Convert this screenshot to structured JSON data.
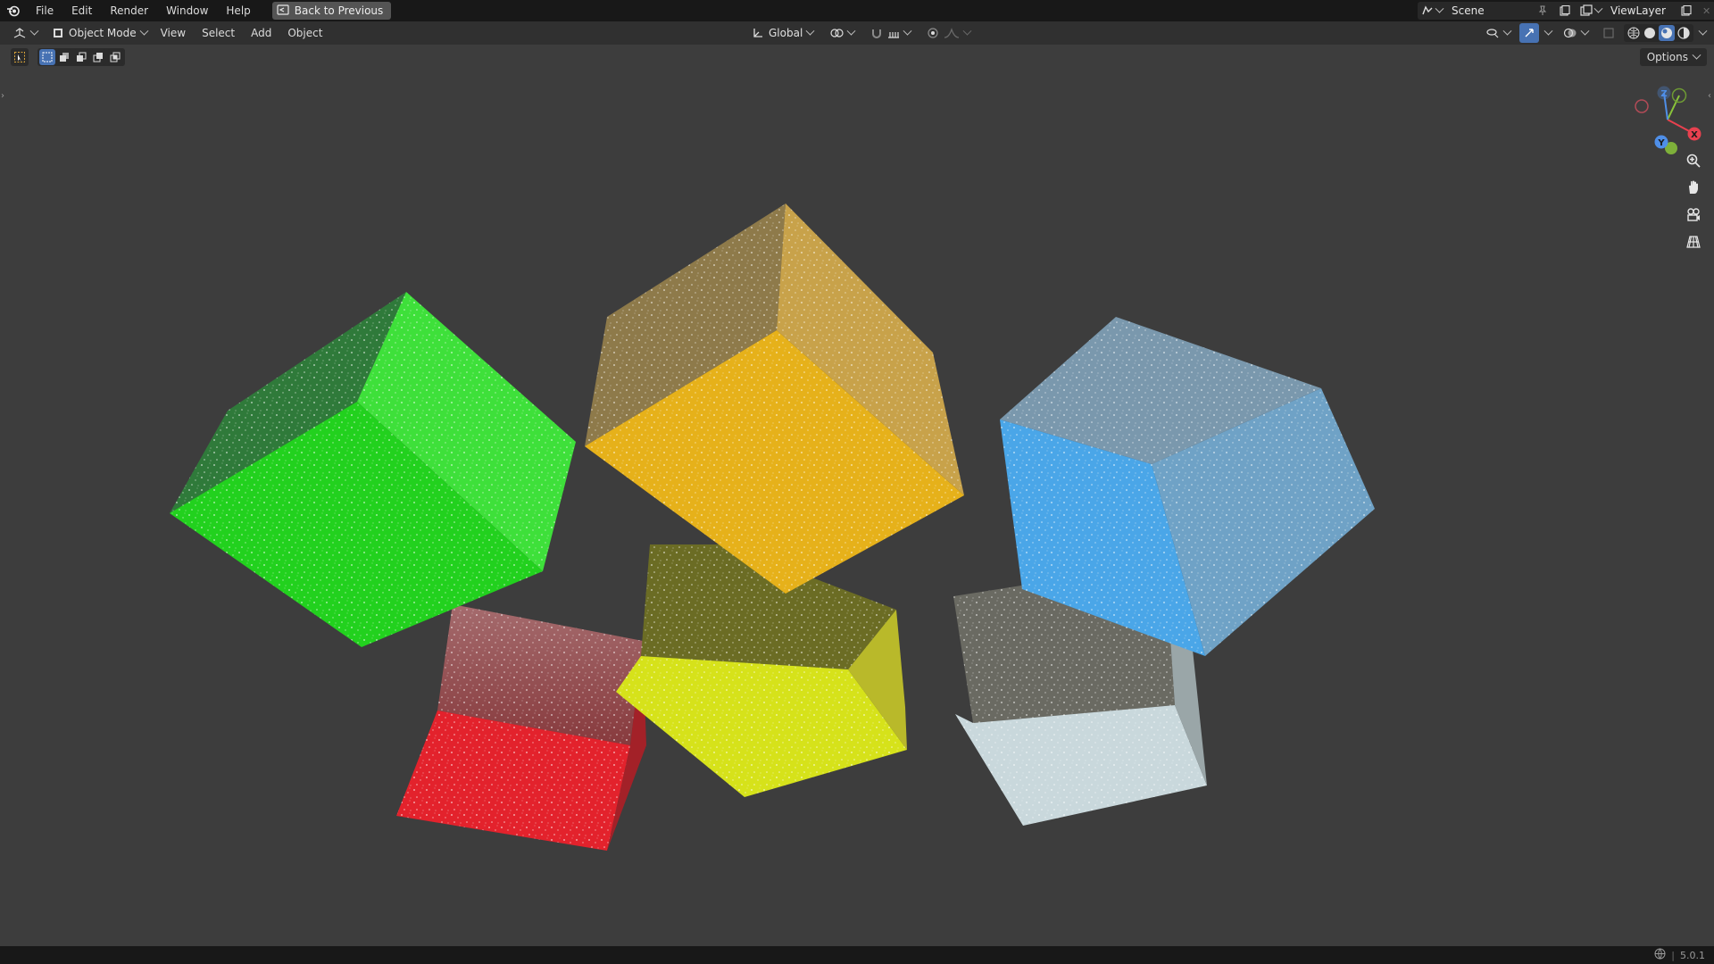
{
  "menu": {
    "file": "File",
    "edit": "Edit",
    "render": "Render",
    "window": "Window",
    "help": "Help",
    "back_to_previous": "Back to Previous"
  },
  "top_right": {
    "scene_label": "Scene",
    "viewlayer_label": "ViewLayer"
  },
  "header": {
    "mode": "Object Mode",
    "view": "View",
    "select": "Select",
    "add": "Add",
    "object": "Object",
    "transform_orientation": "Global",
    "options": "Options"
  },
  "gizmo": {
    "x_label": "X",
    "y_label": "Y",
    "z_label": "Z"
  },
  "status": {
    "version": "5.0.1"
  },
  "colors": {
    "green_cube": "#2fe52a",
    "yellow_cube": "#e6b11a",
    "blue_cube": "#4aa6e8",
    "red_cube": "#e3222c",
    "lime_cube": "#d6e21a",
    "clear_cube": "#c9d8dc",
    "axis_x": "#e8414f",
    "axis_y": "#8ac43a",
    "axis_z": "#4f8fe8"
  }
}
